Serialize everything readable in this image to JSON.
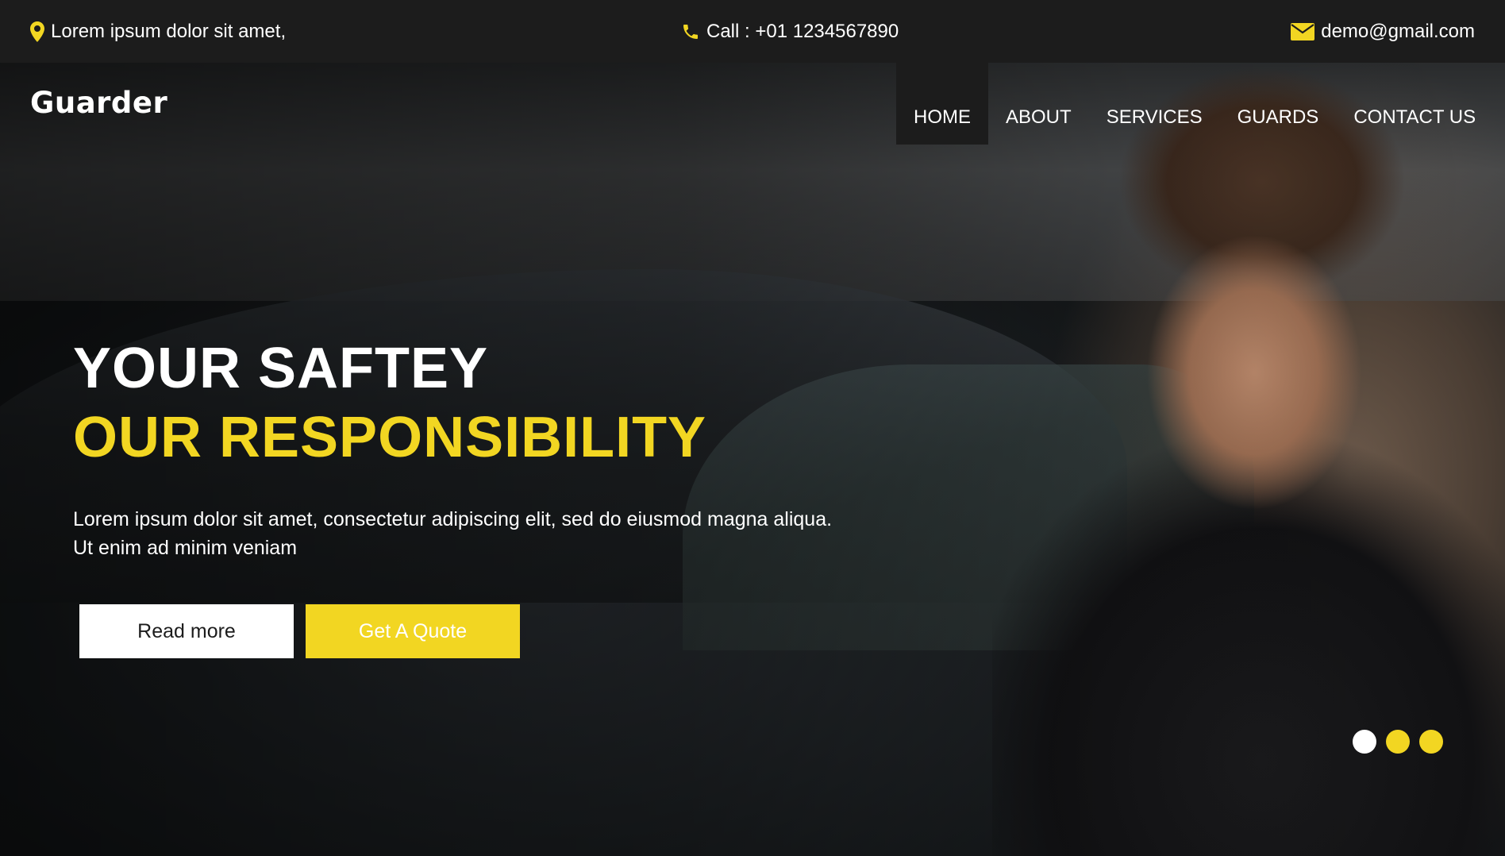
{
  "topbar": {
    "address": "Lorem ipsum dolor sit amet,",
    "address_icon": "location-pin-icon",
    "phone": "Call : +01 1234567890",
    "phone_icon": "phone-icon",
    "email": "demo@gmail.com",
    "email_icon": "envelope-icon"
  },
  "header": {
    "brand": "Guarder",
    "nav": [
      {
        "label": "HOME",
        "active": true
      },
      {
        "label": "ABOUT",
        "active": false
      },
      {
        "label": "SERVICES",
        "active": false
      },
      {
        "label": "GUARDS",
        "active": false
      },
      {
        "label": "CONTACT US",
        "active": false
      }
    ]
  },
  "hero": {
    "title_line1": "YOUR SAFTEY",
    "title_line2": "OUR RESPONSIBILITY",
    "lead": "Lorem ipsum dolor sit amet, consectetur adipiscing elit, sed do eiusmod magna aliqua. Ut enim ad minim veniam",
    "read_more": "Read more",
    "get_quote": "Get A Quote",
    "slides": [
      {
        "color": "#ffffff",
        "active": true
      },
      {
        "color": "#f2d622",
        "active": false
      },
      {
        "color": "#f2d622",
        "active": false
      }
    ]
  },
  "colors": {
    "accent": "#f2d622",
    "topbar_bg": "#1c1c1c"
  }
}
